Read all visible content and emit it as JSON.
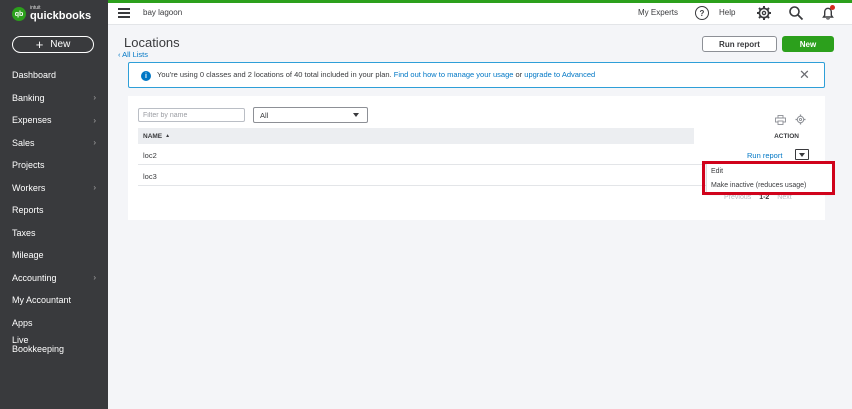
{
  "app": {
    "brand_small": "intuit",
    "brand_name": "quickbooks",
    "logo_mark": "qb"
  },
  "sidebar": {
    "new_label": "New",
    "items": [
      {
        "label": "Dashboard",
        "has_chevron": false
      },
      {
        "label": "Banking",
        "has_chevron": true
      },
      {
        "label": "Expenses",
        "has_chevron": true
      },
      {
        "label": "Sales",
        "has_chevron": true
      },
      {
        "label": "Projects",
        "has_chevron": false
      },
      {
        "label": "Workers",
        "has_chevron": true
      },
      {
        "label": "Reports",
        "has_chevron": false
      },
      {
        "label": "Taxes",
        "has_chevron": false
      },
      {
        "label": "Mileage",
        "has_chevron": false
      },
      {
        "label": "Accounting",
        "has_chevron": true
      },
      {
        "label": "My Accountant",
        "has_chevron": false
      },
      {
        "label": "Apps",
        "has_chevron": false
      },
      {
        "label": "Live Bookkeeping",
        "has_chevron": false
      }
    ]
  },
  "header": {
    "company": "bay lagoon",
    "my_experts": "My Experts",
    "help": "Help"
  },
  "page": {
    "title": "Locations",
    "back_link": "All Lists",
    "run_report_button": "Run report",
    "new_button": "New"
  },
  "banner": {
    "text": "You're using 0 classes and 2 locations of 40 total included in your plan.",
    "link1": "Find out how to manage your usage",
    "joiner": "or",
    "link2": "upgrade to Advanced"
  },
  "table": {
    "filter_placeholder": "Filter by name",
    "status_filter": "All",
    "col_name": "NAME",
    "col_action": "ACTION",
    "rows": [
      {
        "name": "loc2"
      },
      {
        "name": "loc3"
      }
    ],
    "row_action": "Run report",
    "pagination": {
      "previous": "Previous",
      "current": "1-2",
      "next": "Next"
    }
  },
  "action_menu": {
    "items": [
      "Edit",
      "Make inactive (reduces usage)"
    ]
  },
  "colors": {
    "brand_green": "#2ca01c",
    "link_blue": "#0077c5",
    "sidebar_bg": "#393a3d",
    "highlight_red": "#d0021b"
  }
}
